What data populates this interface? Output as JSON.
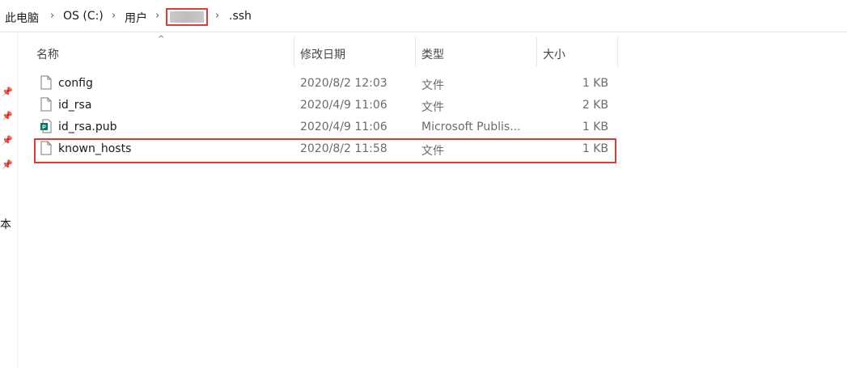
{
  "breadcrumb": {
    "items": [
      "此电脑",
      "OS (C:)",
      "用户",
      ".ssh"
    ]
  },
  "columns": {
    "name": "名称",
    "date": "修改日期",
    "type": "类型",
    "size": "大小"
  },
  "files": [
    {
      "name": "config",
      "date": "2020/8/2 12:03",
      "type": "文件",
      "size": "1 KB",
      "icon": "blank-file-icon"
    },
    {
      "name": "id_rsa",
      "date": "2020/4/9 11:06",
      "type": "文件",
      "size": "2 KB",
      "icon": "blank-file-icon"
    },
    {
      "name": "id_rsa.pub",
      "date": "2020/4/9 11:06",
      "type": "Microsoft Publis...",
      "size": "1 KB",
      "icon": "publisher-file-icon"
    },
    {
      "name": "known_hosts",
      "date": "2020/8/2 11:58",
      "type": "文件",
      "size": "1 KB",
      "icon": "blank-file-icon"
    }
  ],
  "sidebar": {
    "partial_label": "本"
  },
  "colors": {
    "highlight": "#e53935",
    "publisher_green": "#077568"
  }
}
